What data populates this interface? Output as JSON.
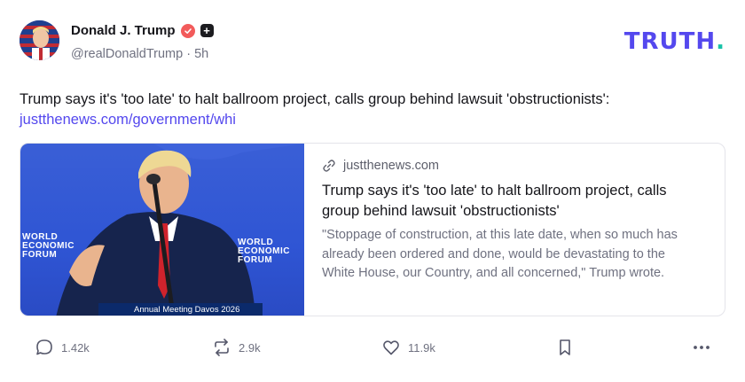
{
  "author": {
    "display_name": "Donald J. Trump",
    "handle": "@realDonaldTrump",
    "separator": "·",
    "time": "5h",
    "plus_badge": "+"
  },
  "brand": {
    "name": "TRUTH",
    "dot": "."
  },
  "post": {
    "text": "Trump says it's 'too late' to halt ballroom project, calls group behind lawsuit 'obstructionists':",
    "link": "justthenews.com/government/whi"
  },
  "card": {
    "domain": "justthenews.com",
    "title": "Trump says it's 'too late' to halt ballroom project, calls group behind lawsuit 'obstructionists'",
    "description": "\"Stoppage of construction, at this late date, when so much has already been ordered and done, would be devastating to the White House, our Country, and all concerned,\" Trump wrote.",
    "image": {
      "wef_left": "WORLD ECONOMIC FORUM",
      "wef_right": "WORLD ECONOMIC FORUM",
      "banner": "Annual Meeting Davos 2026"
    }
  },
  "actions": {
    "replies": "1.42k",
    "retruths": "2.9k",
    "likes": "11.9k"
  },
  "colors": {
    "brand": "#5448ee",
    "brand_dot": "#18c2a8",
    "verified": "#f25b5b",
    "link": "#5448ee"
  }
}
